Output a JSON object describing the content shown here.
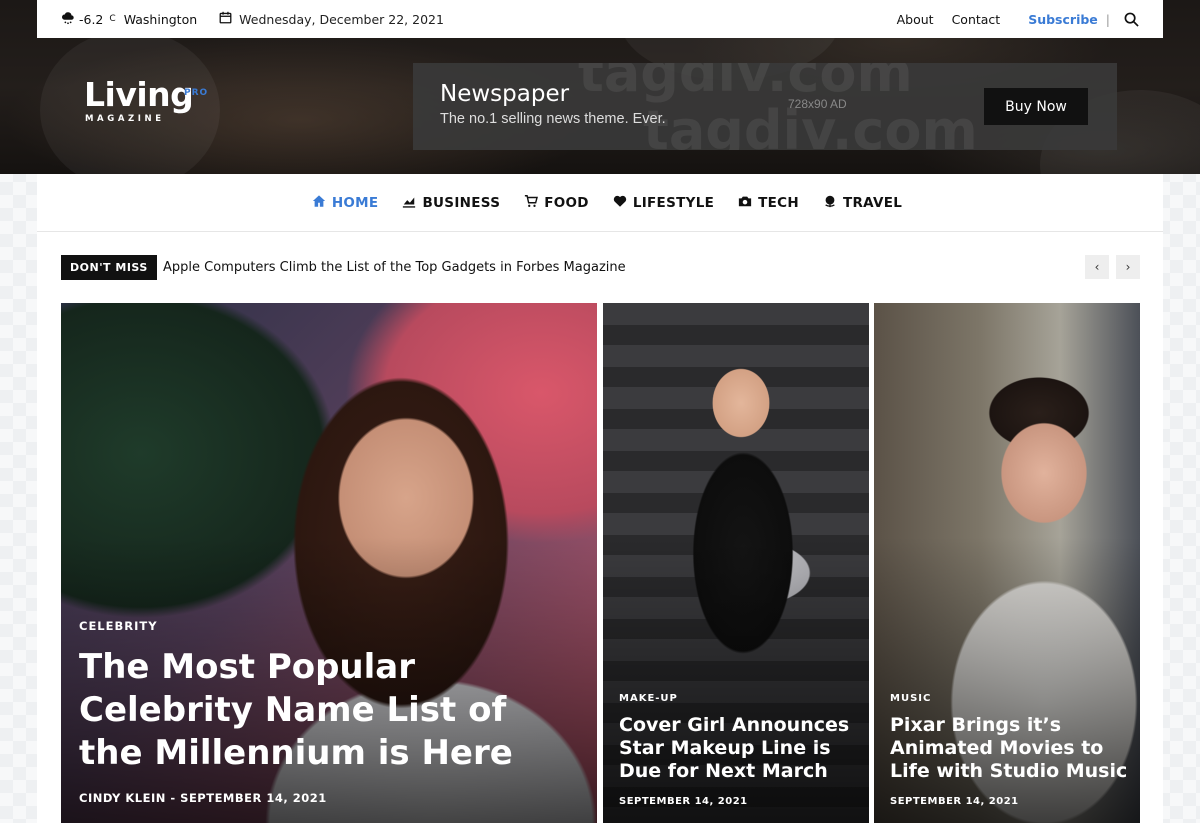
{
  "topbar": {
    "temperature": "-6.2",
    "unit": "C",
    "city": "Washington",
    "date": "Wednesday, December 22, 2021",
    "links": [
      "About",
      "Contact"
    ],
    "subscribe": "Subscribe",
    "separator": "|"
  },
  "logo": {
    "word": "Living",
    "badge": "PRO",
    "sub": "MAGAZINE"
  },
  "ad": {
    "title": "Newspaper",
    "tagline": "The no.1 selling news theme. Ever.",
    "size": "728x90 AD",
    "button": "Buy Now",
    "watermark": "tagdiv.com"
  },
  "nav": {
    "items": [
      {
        "label": "HOME",
        "icon": "home-icon",
        "active": true
      },
      {
        "label": "BUSINESS",
        "icon": "chart-icon"
      },
      {
        "label": "FOOD",
        "icon": "cart-icon"
      },
      {
        "label": "LIFESTYLE",
        "icon": "heart-icon"
      },
      {
        "label": "TECH",
        "icon": "camera-icon"
      },
      {
        "label": "TRAVEL",
        "icon": "globe-icon"
      }
    ]
  },
  "ticker": {
    "badge": "DON'T MISS",
    "headline": "Apple Computers Climb the List of the Top Gadgets in Forbes Magazine",
    "prev": "‹",
    "next": "›"
  },
  "featured": [
    {
      "category": "CELEBRITY",
      "title": "The Most Popular Celebrity Name List of the Millennium is Here",
      "meta": "CINDY KLEIN  -  SEPTEMBER 14, 2021"
    },
    {
      "category": "MAKE-UP",
      "title": "Cover Girl Announces Star Makeup Line is Due for Next March",
      "meta": "SEPTEMBER 14, 2021"
    },
    {
      "category": "MUSIC",
      "title": "Pixar Brings it’s Animated Movies to Life with Studio Music",
      "meta": "SEPTEMBER 14, 2021"
    }
  ],
  "colors": {
    "accent": "#3a7bd5",
    "dark": "#111111"
  }
}
